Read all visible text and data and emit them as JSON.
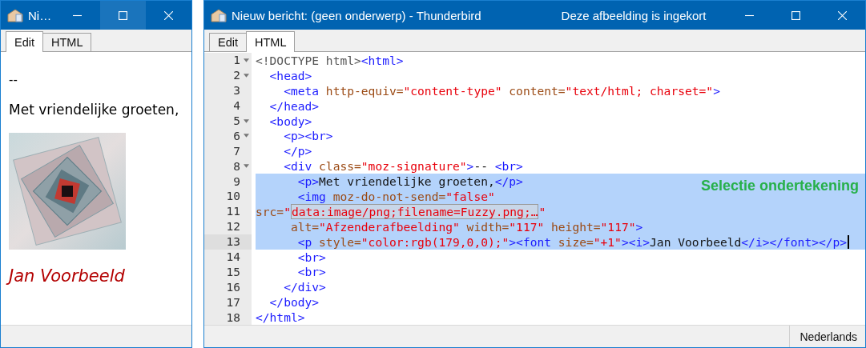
{
  "small_window": {
    "title": "Ni…",
    "maximize_hovered": true,
    "tabs": [
      {
        "label": "Edit",
        "selected": true
      },
      {
        "label": "HTML",
        "selected": false
      }
    ],
    "content": {
      "dashes": "--",
      "greeting": "Met vriendelijke groeten,",
      "name": "Jan Voorbeeld"
    }
  },
  "main_window": {
    "title": "Nieuw bericht: (geen onderwerp) - Thunderbird",
    "notice": "Deze afbeelding is ingekort",
    "tabs": [
      {
        "label": "Edit",
        "selected": false
      },
      {
        "label": "HTML",
        "selected": true
      }
    ],
    "annotation": "Selectie ondertekening",
    "code_lines": [
      {
        "number": "1",
        "fold": true,
        "selected": false,
        "current": false,
        "tokens": [
          {
            "kind": "doctype",
            "text": "<!DOCTYPE html>"
          },
          {
            "kind": "tag",
            "text": "<html>"
          }
        ]
      },
      {
        "number": "2",
        "fold": true,
        "selected": false,
        "current": false,
        "tokens": [
          {
            "kind": "tag",
            "text": "  <head>"
          }
        ]
      },
      {
        "number": "3",
        "fold": false,
        "selected": false,
        "current": false,
        "tokens": [
          {
            "kind": "tag",
            "text": "    <meta"
          },
          {
            "kind": "attr",
            "text": " http-equiv="
          },
          {
            "kind": "value",
            "text": "\"content-type\""
          },
          {
            "kind": "attr",
            "text": " content="
          },
          {
            "kind": "value",
            "text": "\"text/html; charset=\""
          },
          {
            "kind": "tag",
            "text": ">"
          }
        ]
      },
      {
        "number": "4",
        "fold": false,
        "selected": false,
        "current": false,
        "tokens": [
          {
            "kind": "tag",
            "text": "  </head>"
          }
        ]
      },
      {
        "number": "5",
        "fold": true,
        "selected": false,
        "current": false,
        "tokens": [
          {
            "kind": "tag",
            "text": "  <body>"
          }
        ]
      },
      {
        "number": "6",
        "fold": true,
        "selected": false,
        "current": false,
        "tokens": [
          {
            "kind": "tag",
            "text": "    <p><br>"
          }
        ]
      },
      {
        "number": "7",
        "fold": false,
        "selected": false,
        "current": false,
        "tokens": [
          {
            "kind": "tag",
            "text": "    </p>"
          }
        ]
      },
      {
        "number": "8",
        "fold": true,
        "selected": false,
        "current": false,
        "tokens": [
          {
            "kind": "tag",
            "text": "    <div"
          },
          {
            "kind": "attr",
            "text": " class="
          },
          {
            "kind": "value",
            "text": "\"moz-signature\""
          },
          {
            "kind": "tag",
            "text": ">"
          },
          {
            "kind": "text",
            "text": "-- "
          },
          {
            "kind": "tag",
            "text": "<br>"
          }
        ]
      },
      {
        "number": "9",
        "fold": false,
        "selected": true,
        "current": false,
        "tokens": [
          {
            "kind": "tag",
            "text": "      <p>"
          },
          {
            "kind": "text",
            "text": "Met vriendelijke groeten,"
          },
          {
            "kind": "tag",
            "text": "</p>"
          }
        ]
      },
      {
        "number": "10",
        "fold": false,
        "selected": true,
        "current": false,
        "tokens": [
          {
            "kind": "tag",
            "text": "      <img"
          },
          {
            "kind": "attr",
            "text": " moz-do-not-send="
          },
          {
            "kind": "value",
            "text": "\"false\""
          }
        ]
      },
      {
        "number": "11",
        "fold": false,
        "selected": true,
        "current": false,
        "tokens": [
          {
            "kind": "attr",
            "text": "src="
          },
          {
            "kind": "value",
            "text": "\""
          },
          {
            "kind": "collapsed",
            "text": "data:image/png;filename=Fuzzy.png;…"
          },
          {
            "kind": "value",
            "text": "\""
          }
        ]
      },
      {
        "number": "12",
        "fold": false,
        "selected": true,
        "current": false,
        "tokens": [
          {
            "kind": "attr",
            "text": "     alt="
          },
          {
            "kind": "value",
            "text": "\"Afzenderafbeelding\""
          },
          {
            "kind": "attr",
            "text": " width="
          },
          {
            "kind": "value",
            "text": "\"117\""
          },
          {
            "kind": "attr",
            "text": " height="
          },
          {
            "kind": "value",
            "text": "\"117\""
          },
          {
            "kind": "tag",
            "text": ">"
          }
        ]
      },
      {
        "number": "13",
        "fold": false,
        "selected": true,
        "current": true,
        "tokens": [
          {
            "kind": "tag",
            "text": "      <p"
          },
          {
            "kind": "attr",
            "text": " style="
          },
          {
            "kind": "value",
            "text": "\"color:rgb(179,0,0);\""
          },
          {
            "kind": "tag",
            "text": "><font"
          },
          {
            "kind": "attr",
            "text": " size="
          },
          {
            "kind": "value",
            "text": "\"+1\""
          },
          {
            "kind": "tag",
            "text": "><i>"
          },
          {
            "kind": "text",
            "text": "Jan Voorbeeld"
          },
          {
            "kind": "tag",
            "text": "</i></font></p>"
          }
        ]
      },
      {
        "number": "14",
        "fold": false,
        "selected": false,
        "current": false,
        "tokens": [
          {
            "kind": "tag",
            "text": "      <br>"
          }
        ]
      },
      {
        "number": "15",
        "fold": false,
        "selected": false,
        "current": false,
        "tokens": [
          {
            "kind": "tag",
            "text": "      <br>"
          }
        ]
      },
      {
        "number": "16",
        "fold": false,
        "selected": false,
        "current": false,
        "tokens": [
          {
            "kind": "tag",
            "text": "    </div>"
          }
        ]
      },
      {
        "number": "17",
        "fold": false,
        "selected": false,
        "current": false,
        "tokens": [
          {
            "kind": "tag",
            "text": "  </body>"
          }
        ]
      },
      {
        "number": "18",
        "fold": false,
        "selected": false,
        "current": false,
        "tokens": [
          {
            "kind": "tag",
            "text": "</html>"
          }
        ]
      }
    ],
    "status_bar": {
      "language": "Nederlands"
    }
  }
}
